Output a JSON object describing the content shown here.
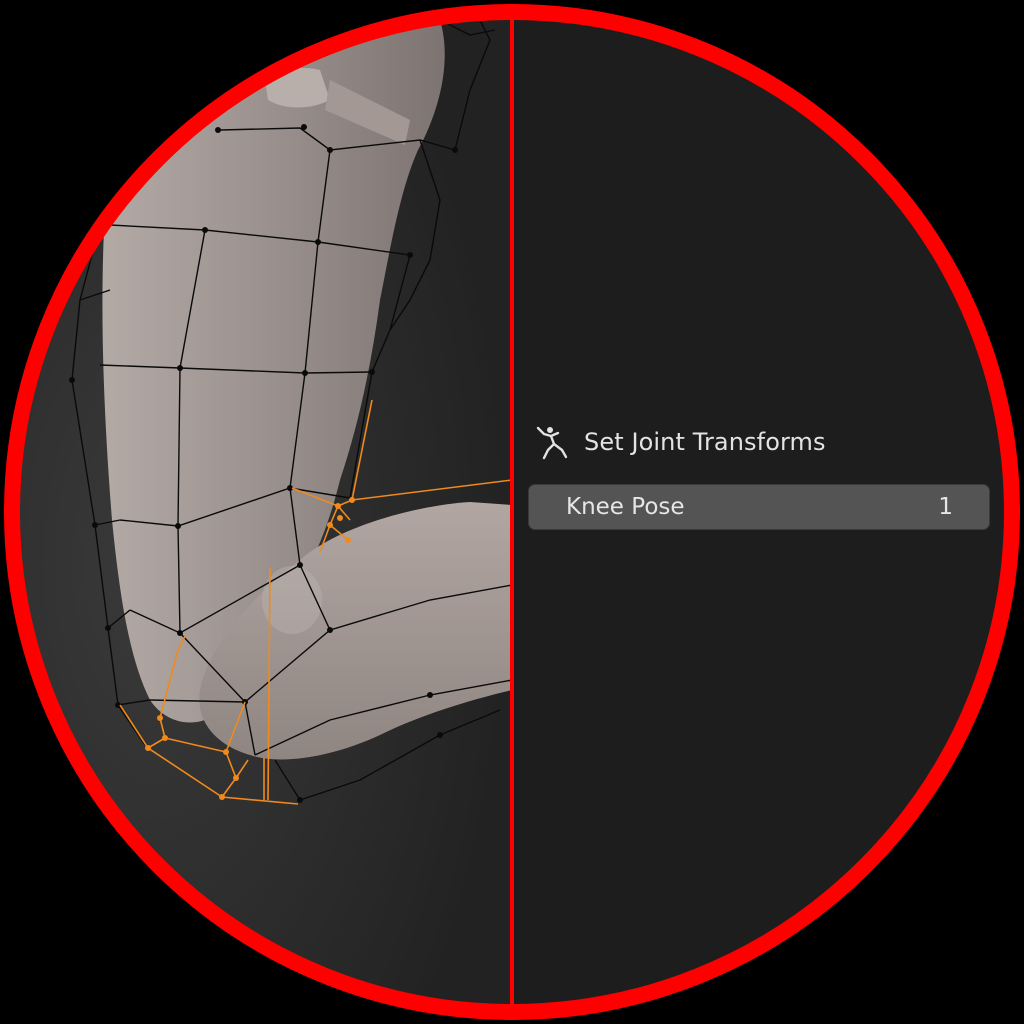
{
  "colors": {
    "ring": "#ff0000",
    "panel_bg": "#1d1d1d",
    "viewport_bg": "#2a2a2a",
    "mesh_skin": "#a69b97",
    "wire": "#0a0a0a",
    "selected_wire": "#f08a1c",
    "field_bg": "#545454",
    "text": "#e3e3e3"
  },
  "viewport": {
    "subject": "3d-leg-mesh-with-wireframe-cage"
  },
  "operator_panel": {
    "icon": "running-figure-icon",
    "title": "Set Joint Transforms",
    "property": {
      "label": "Knee Pose",
      "value": "1"
    }
  }
}
